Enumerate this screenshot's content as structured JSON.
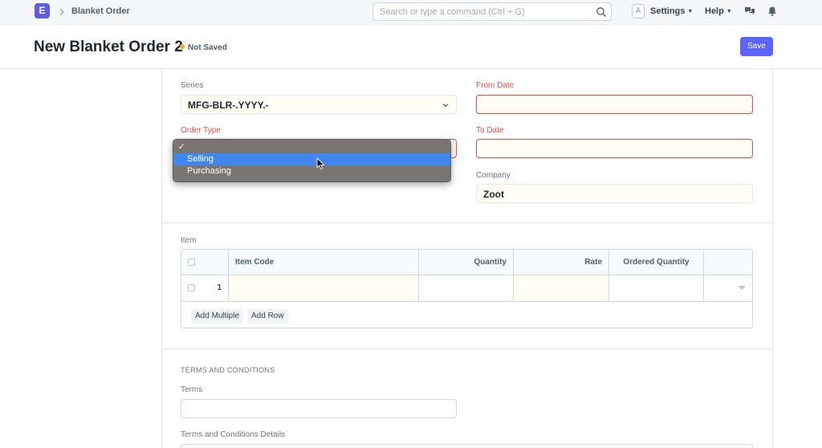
{
  "navbar": {
    "logo_letter": "E",
    "breadcrumb": "Blanket Order",
    "search_placeholder": "Search or type a command (Ctrl + G)",
    "avatar_letter": "A",
    "settings_label": "Settings",
    "help_label": "Help"
  },
  "page": {
    "title": "New Blanket Order 2",
    "status": "Not Saved",
    "save_label": "Save"
  },
  "fields": {
    "series_label": "Series",
    "series_value": "MFG-BLR-.YYYY.-",
    "order_type_label": "Order Type",
    "from_date_label": "From Date",
    "to_date_label": "To Date",
    "company_label": "Company",
    "company_value": "Zoot"
  },
  "order_type_dropdown": {
    "options": [
      {
        "label": "",
        "checked": true
      },
      {
        "label": "Selling",
        "highlighted": true
      },
      {
        "label": "Purchasing"
      }
    ]
  },
  "items": {
    "label": "Item",
    "columns": [
      "Item Code",
      "Quantity",
      "Rate",
      "Ordered Quantity"
    ],
    "rows": [
      {
        "no": "1"
      }
    ],
    "add_multiple_label": "Add Multiple",
    "add_row_label": "Add Row"
  },
  "terms": {
    "section_title": "TERMS AND CONDITIONS",
    "terms_label": "Terms",
    "details_label": "Terms and Conditions Details"
  },
  "colors": {
    "primary": "#5e64ff",
    "required": "#e24c4c",
    "not_saved_dot": "#f8a340",
    "dropdown_highlight": "#3f86ee"
  }
}
